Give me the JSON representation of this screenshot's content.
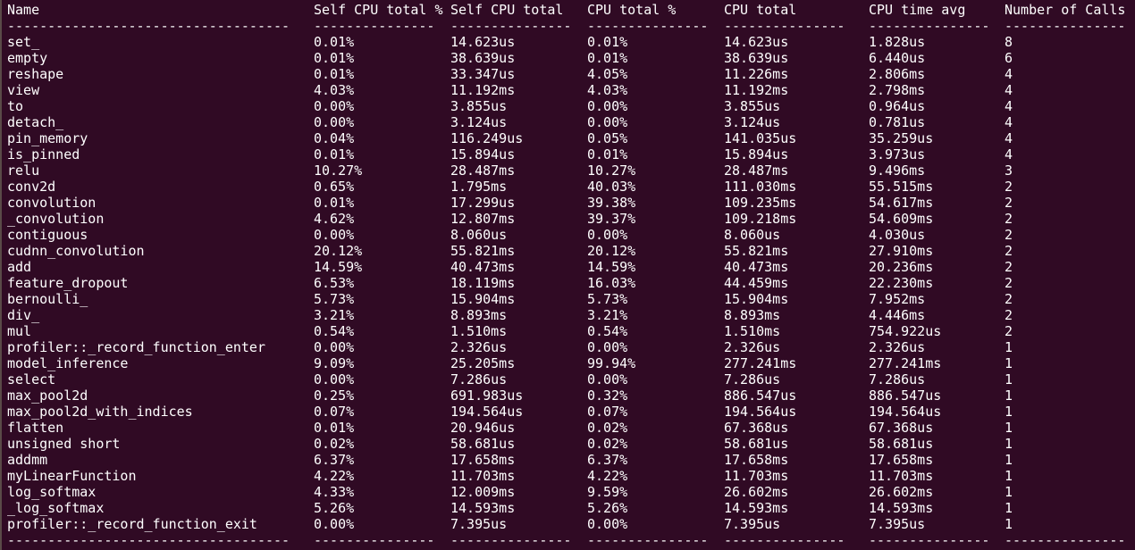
{
  "headers": [
    "Name",
    "Self CPU total %",
    "Self CPU total",
    "CPU total %",
    "CPU total",
    "CPU time avg",
    "Number of Calls"
  ],
  "separators": [
    "-----------------------------------",
    "---------------",
    "---------------",
    "---------------",
    "---------------",
    "---------------",
    "---------------"
  ],
  "rows": [
    [
      "set_",
      "0.01%",
      "14.623us",
      "0.01%",
      "14.623us",
      "1.828us",
      "8"
    ],
    [
      "empty",
      "0.01%",
      "38.639us",
      "0.01%",
      "38.639us",
      "6.440us",
      "6"
    ],
    [
      "reshape",
      "0.01%",
      "33.347us",
      "4.05%",
      "11.226ms",
      "2.806ms",
      "4"
    ],
    [
      "view",
      "4.03%",
      "11.192ms",
      "4.03%",
      "11.192ms",
      "2.798ms",
      "4"
    ],
    [
      "to",
      "0.00%",
      "3.855us",
      "0.00%",
      "3.855us",
      "0.964us",
      "4"
    ],
    [
      "detach_",
      "0.00%",
      "3.124us",
      "0.00%",
      "3.124us",
      "0.781us",
      "4"
    ],
    [
      "pin_memory",
      "0.04%",
      "116.249us",
      "0.05%",
      "141.035us",
      "35.259us",
      "4"
    ],
    [
      "is_pinned",
      "0.01%",
      "15.894us",
      "0.01%",
      "15.894us",
      "3.973us",
      "4"
    ],
    [
      "relu",
      "10.27%",
      "28.487ms",
      "10.27%",
      "28.487ms",
      "9.496ms",
      "3"
    ],
    [
      "conv2d",
      "0.65%",
      "1.795ms",
      "40.03%",
      "111.030ms",
      "55.515ms",
      "2"
    ],
    [
      "convolution",
      "0.01%",
      "17.299us",
      "39.38%",
      "109.235ms",
      "54.617ms",
      "2"
    ],
    [
      "_convolution",
      "4.62%",
      "12.807ms",
      "39.37%",
      "109.218ms",
      "54.609ms",
      "2"
    ],
    [
      "contiguous",
      "0.00%",
      "8.060us",
      "0.00%",
      "8.060us",
      "4.030us",
      "2"
    ],
    [
      "cudnn_convolution",
      "20.12%",
      "55.821ms",
      "20.12%",
      "55.821ms",
      "27.910ms",
      "2"
    ],
    [
      "add",
      "14.59%",
      "40.473ms",
      "14.59%",
      "40.473ms",
      "20.236ms",
      "2"
    ],
    [
      "feature_dropout",
      "6.53%",
      "18.119ms",
      "16.03%",
      "44.459ms",
      "22.230ms",
      "2"
    ],
    [
      "bernoulli_",
      "5.73%",
      "15.904ms",
      "5.73%",
      "15.904ms",
      "7.952ms",
      "2"
    ],
    [
      "div_",
      "3.21%",
      "8.893ms",
      "3.21%",
      "8.893ms",
      "4.446ms",
      "2"
    ],
    [
      "mul",
      "0.54%",
      "1.510ms",
      "0.54%",
      "1.510ms",
      "754.922us",
      "2"
    ],
    [
      "profiler::_record_function_enter",
      "0.00%",
      "2.326us",
      "0.00%",
      "2.326us",
      "2.326us",
      "1"
    ],
    [
      "model_inference",
      "9.09%",
      "25.205ms",
      "99.94%",
      "277.241ms",
      "277.241ms",
      "1"
    ],
    [
      "select",
      "0.00%",
      "7.286us",
      "0.00%",
      "7.286us",
      "7.286us",
      "1"
    ],
    [
      "max_pool2d",
      "0.25%",
      "691.983us",
      "0.32%",
      "886.547us",
      "886.547us",
      "1"
    ],
    [
      "max_pool2d_with_indices",
      "0.07%",
      "194.564us",
      "0.07%",
      "194.564us",
      "194.564us",
      "1"
    ],
    [
      "flatten",
      "0.01%",
      "20.946us",
      "0.02%",
      "67.368us",
      "67.368us",
      "1"
    ],
    [
      "unsigned short",
      "0.02%",
      "58.681us",
      "0.02%",
      "58.681us",
      "58.681us",
      "1"
    ],
    [
      "addmm",
      "6.37%",
      "17.658ms",
      "6.37%",
      "17.658ms",
      "17.658ms",
      "1"
    ],
    [
      "myLinearFunction",
      "4.22%",
      "11.703ms",
      "4.22%",
      "11.703ms",
      "11.703ms",
      "1"
    ],
    [
      "log_softmax",
      "4.33%",
      "12.009ms",
      "9.59%",
      "26.602ms",
      "26.602ms",
      "1"
    ],
    [
      "_log_softmax",
      "5.26%",
      "14.593ms",
      "5.26%",
      "14.593ms",
      "14.593ms",
      "1"
    ],
    [
      "profiler::_record_function_exit",
      "0.00%",
      "7.395us",
      "0.00%",
      "7.395us",
      "7.395us",
      "1"
    ]
  ]
}
